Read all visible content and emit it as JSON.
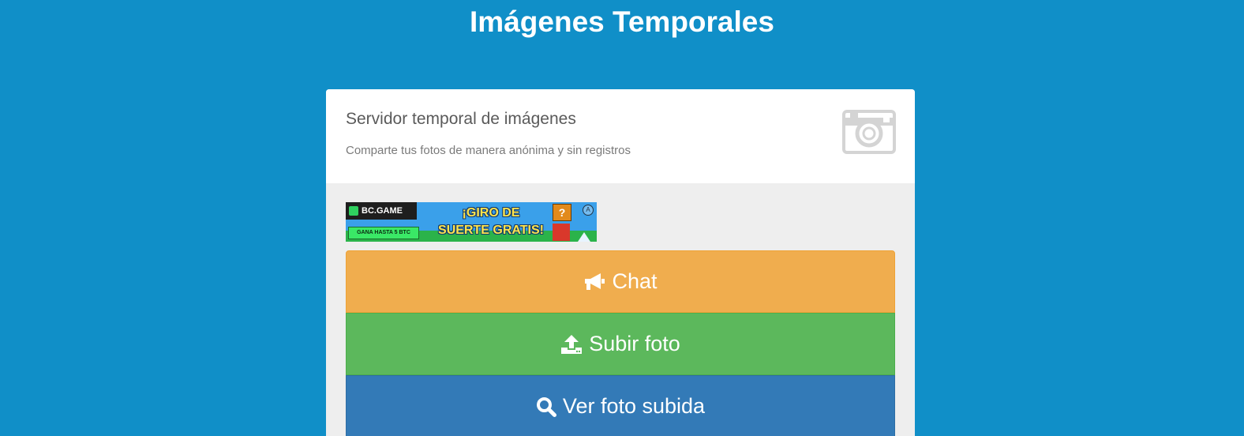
{
  "header": {
    "title": "Imágenes Temporales"
  },
  "panel": {
    "title": "Servidor temporal de imágenes",
    "subtitle": "Comparte tus fotos de manera anónima y sin registros",
    "icon": "camera-icon"
  },
  "ad": {
    "brand": "BC.GAME",
    "tag": "GANA HASTA 5 BTC",
    "headline_line1": "¡GIRO DE",
    "headline_line2": "SUERTE GRATIS!",
    "qblock": "?",
    "info": "A"
  },
  "actions": {
    "chat": {
      "label": "Chat",
      "icon": "megaphone-icon",
      "color": "#f0ad4e"
    },
    "upload": {
      "label": "Subir foto",
      "icon": "upload-icon",
      "color": "#5cb85c"
    },
    "view": {
      "label": "Ver foto subida",
      "icon": "search-icon",
      "color": "#337ab7"
    }
  },
  "colors": {
    "background": "#108fc8",
    "panel_bg": "#eeeeee",
    "header_bg": "#ffffff"
  }
}
